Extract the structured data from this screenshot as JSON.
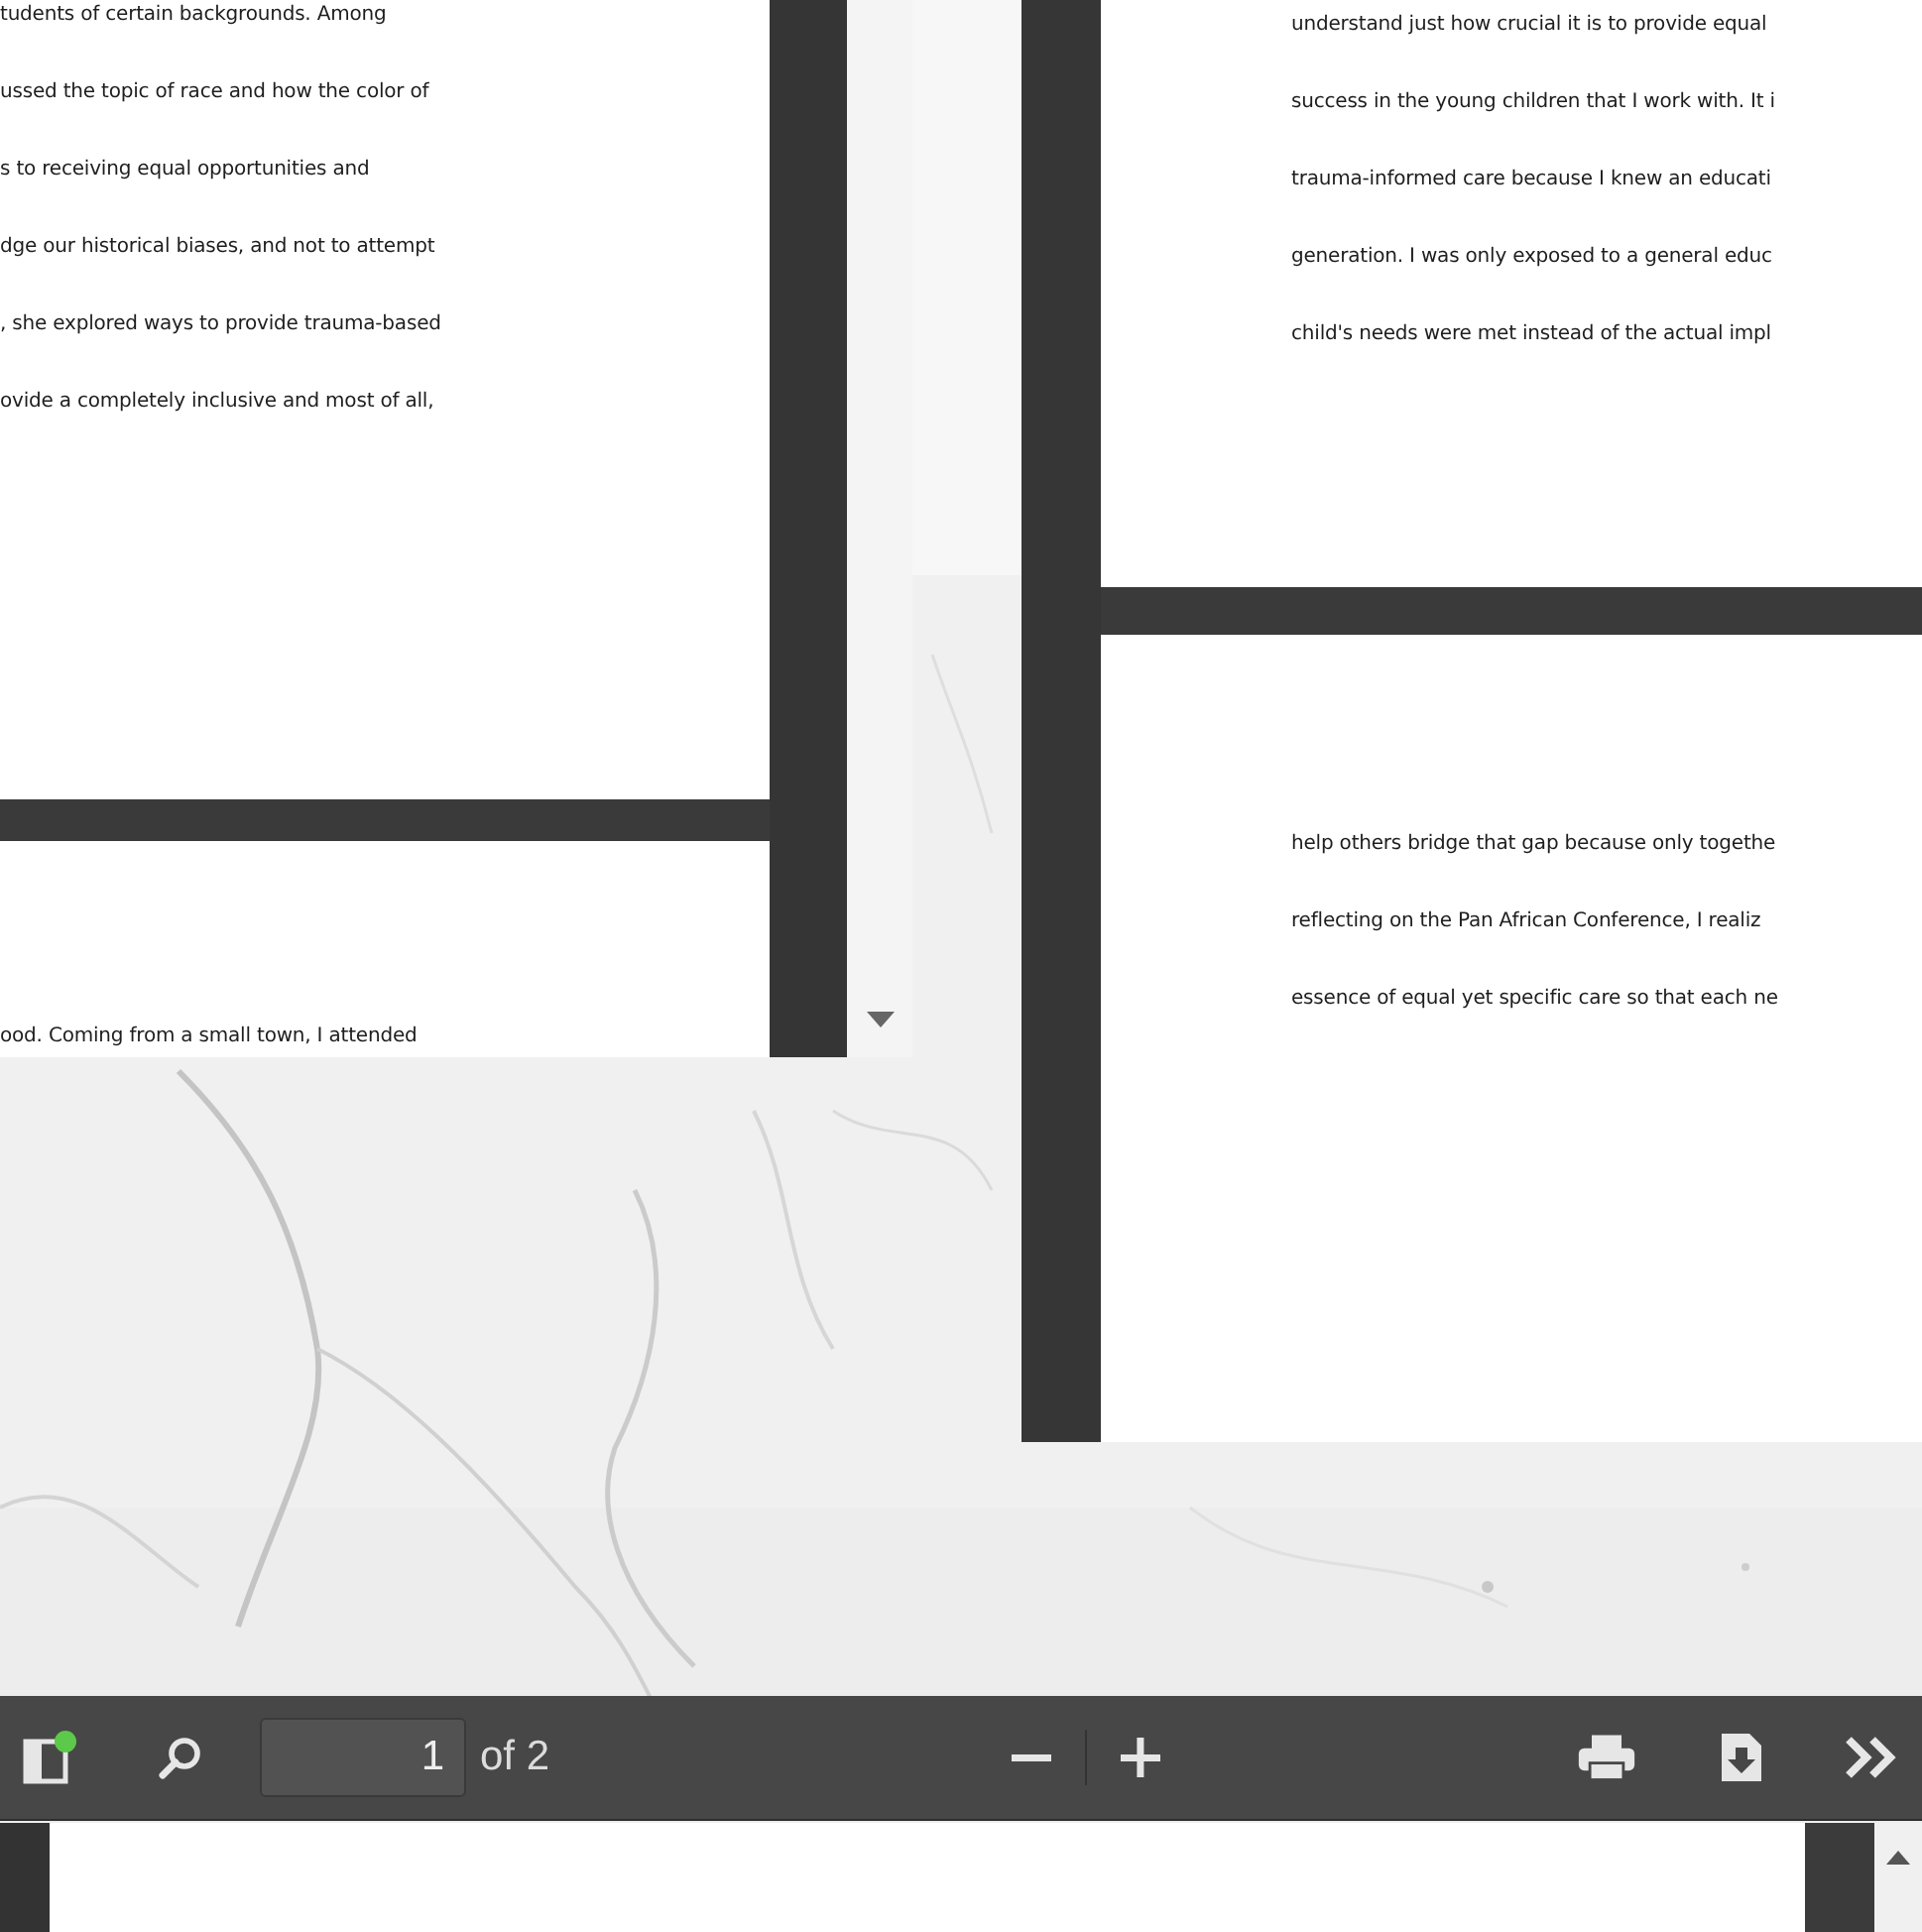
{
  "left_viewer": {
    "page_1_lines": [
      "tudents of certain backgrounds. Among",
      "ussed the topic of race and how the color of",
      "s to receiving equal opportunities and",
      "dge our historical biases, and not to attempt",
      ", she explored ways to provide trauma-based",
      "ovide a completely inclusive and most of all,"
    ],
    "page_2_lines": [
      "ood. Coming from a small town, I attended"
    ]
  },
  "right_viewer": {
    "page_1_lines": [
      "understand just how crucial it is to provide equal",
      "success in the young children that I work with. It i",
      "trauma-informed care because I knew an educati",
      "generation. I was only exposed to a general educ",
      "child's needs were met instead of the actual impl"
    ],
    "page_2_lines": [
      "help others bridge that gap because only togethe",
      "reflecting on the Pan African Conference, I realiz",
      "essence of equal yet specific care so that each ne"
    ]
  },
  "toolbar": {
    "page_number": "1",
    "page_count": "of 2"
  }
}
